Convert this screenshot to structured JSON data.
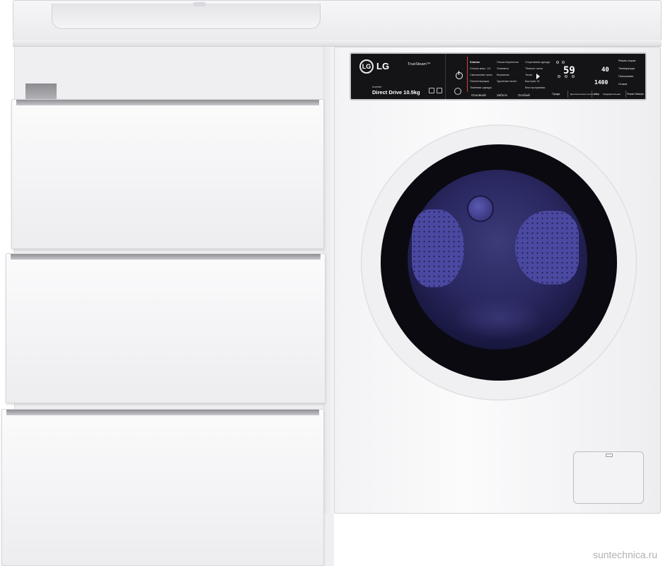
{
  "brand": {
    "logo_letters": "LG",
    "name": "LG",
    "feature": "TrueSteam™",
    "line1": "Inverter",
    "line2": "Direct Drive 10.5kg"
  },
  "panel": {
    "programs_header": "Хлопок",
    "programs": [
      "Хлопок",
      "Хлопок макс. 1/2",
      "Смешанная ткань",
      "Пеногенерация",
      "Тканевая одежда",
      "Гипоаллергенная",
      "Освежить",
      "Бережная",
      "Удаление пятен",
      "Спортивная одежда",
      "Тёмные ткани",
      "Тихая",
      "Быстрая 14'",
      "Мои программы"
    ],
    "groups": [
      "Основной",
      "Забота",
      "Особый"
    ],
    "display_temp": "40",
    "display_spin": "1400",
    "display_time": "59",
    "options": [
      "Режим стирки",
      "Температура",
      "Полоскание",
      "Отжим"
    ],
    "bottom_buttons": [
      "Предв.",
      "Дополнительное полоскание",
      "Пар",
      "Предварительная",
      "Режим Таймера"
    ]
  },
  "watermark": "suntechnica.ru",
  "colors": {
    "panel": "#141416",
    "glass": "#2a2860",
    "body": "#f3f3f5"
  }
}
